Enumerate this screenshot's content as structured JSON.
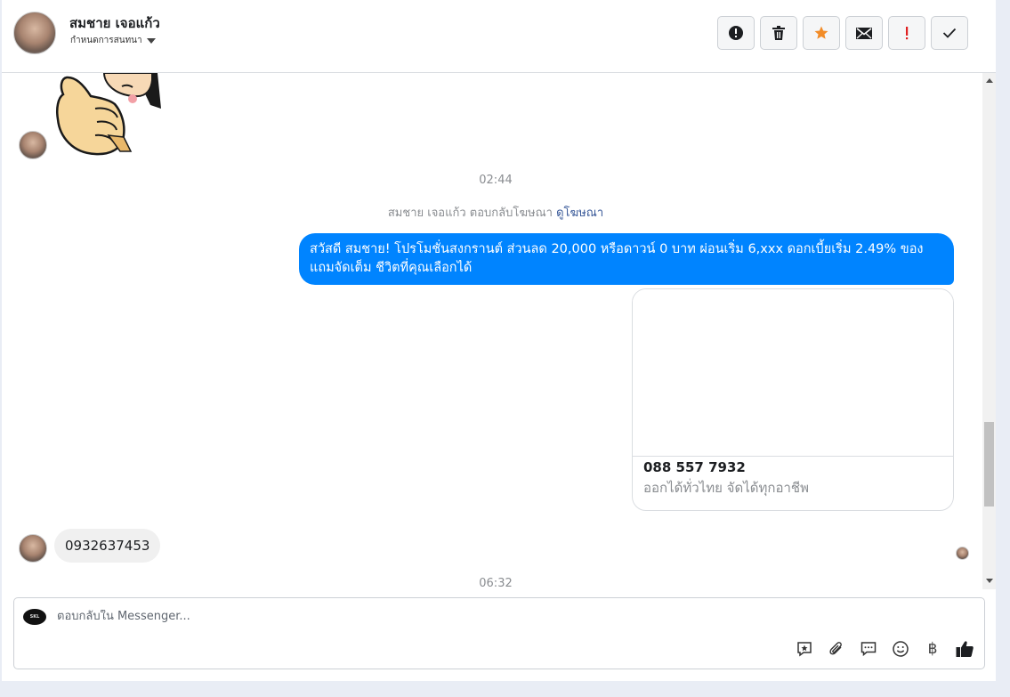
{
  "header": {
    "contact_name": "สมชาย เจอแก้ว",
    "label_dropdown": "กำหนดการสนทนา"
  },
  "toolbar": {
    "buttons": [
      {
        "name": "mark-spam-button",
        "icon": "alert-circle-icon"
      },
      {
        "name": "delete-button",
        "icon": "trash-icon"
      },
      {
        "name": "star-button",
        "icon": "star-icon",
        "color": "#f28c28"
      },
      {
        "name": "mark-unread-button",
        "icon": "envelope-icon"
      },
      {
        "name": "important-button",
        "icon": "exclamation-icon",
        "color": "#e02020"
      },
      {
        "name": "mark-done-button",
        "icon": "check-icon"
      }
    ]
  },
  "conversation": {
    "timestamp_1": "02:44",
    "reply_note": {
      "text": "สมชาย เจอแก้ว ตอบกลับโฆษณา",
      "link": "ดูโฆษณา"
    },
    "outgoing_message": "สวัสดี สมชาย! โปรโมชั่นสงกรานต์ ส่วนลด 20,000 หรือดาวน์ 0 บาท ผ่อนเริ่ม 6,xxx ดอกเบี้ยเริ่ม 2.49% ของแถมจัดเต็ม ชีวิตที่คุณเลือกได้",
    "card": {
      "title": "088 557 7932",
      "subtitle": "ออกได้ทั่วไทย จัดได้ทุกอาชีพ"
    },
    "incoming_message": "0932637453",
    "timestamp_2": "06:32"
  },
  "composer": {
    "placeholder": "ตอบกลับใน Messenger...",
    "icons": [
      "saved-reply-icon",
      "attachment-icon",
      "chat-bubble-icon",
      "emoji-icon",
      "baht-icon",
      "thumbs-up-icon"
    ],
    "baht_symbol": "฿"
  },
  "colors": {
    "outgoing_bubble": "#0084ff",
    "star": "#f28c28",
    "important": "#e02020"
  }
}
